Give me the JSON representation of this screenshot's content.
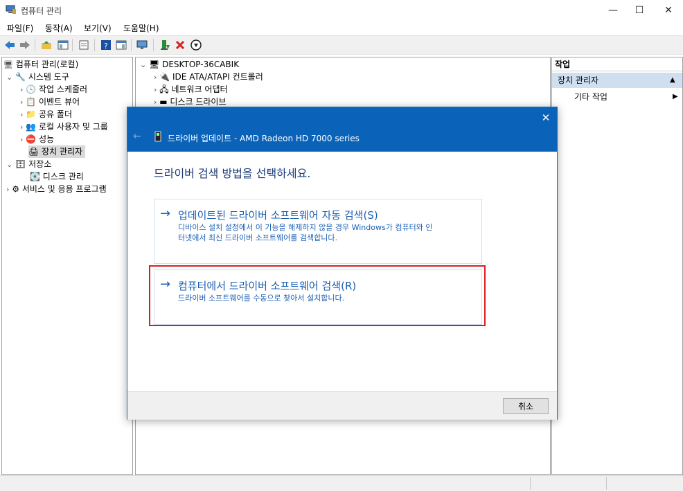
{
  "window": {
    "title": "컴퓨터 관리",
    "minimize": "—",
    "maximize": "☐",
    "close": "✕"
  },
  "menubar": [
    "파일(F)",
    "동작(A)",
    "보기(V)",
    "도움말(H)"
  ],
  "tree": {
    "root": "컴퓨터 관리(로컬)",
    "system_tools": "시스템 도구",
    "task_scheduler": "작업 스케줄러",
    "event_viewer": "이벤트 뷰어",
    "shared_folders": "공유 폴더",
    "local_users": "로컬 사용자 및 그룹",
    "performance": "성능",
    "device_manager": "장치 관리자",
    "storage": "저장소",
    "disk_management": "디스크 관리",
    "services": "서비스 및 응용 프로그램"
  },
  "devices": {
    "computer": "DESKTOP-36CABIK",
    "ide": "IDE ATA/ATAPI 컨트롤러",
    "network": "네트워크 어댑터",
    "disk": "디스크 드라이브"
  },
  "actions": {
    "header": "작업",
    "section": "장치 관리자",
    "more": "기타 작업"
  },
  "dialog": {
    "title": "드라이버 업데이트 - AMD Radeon HD 7000 series",
    "close": "✕",
    "back": "←",
    "heading": "드라이버 검색 방법을 선택하세요.",
    "option1_title": "업데이트된 드라이버 소프트웨어 자동 검색(S)",
    "option1_desc1": "디바이스 설치 설정에서 이 기능을 해제하지 않을 경우 Windows가 컴퓨터와 인",
    "option1_desc2": "터넷에서 최신 드라이버 소프트웨어를 검색합니다.",
    "option2_title": "컴퓨터에서 드라이버 소프트웨어 검색(R)",
    "option2_desc": "드라이버 소프트웨어를 수동으로 찾아서 설치합니다.",
    "arrow": "→",
    "cancel": "취소"
  },
  "colors": {
    "accent": "#0a63b8",
    "highlight": "#e81123",
    "link": "#1a5fb4"
  }
}
